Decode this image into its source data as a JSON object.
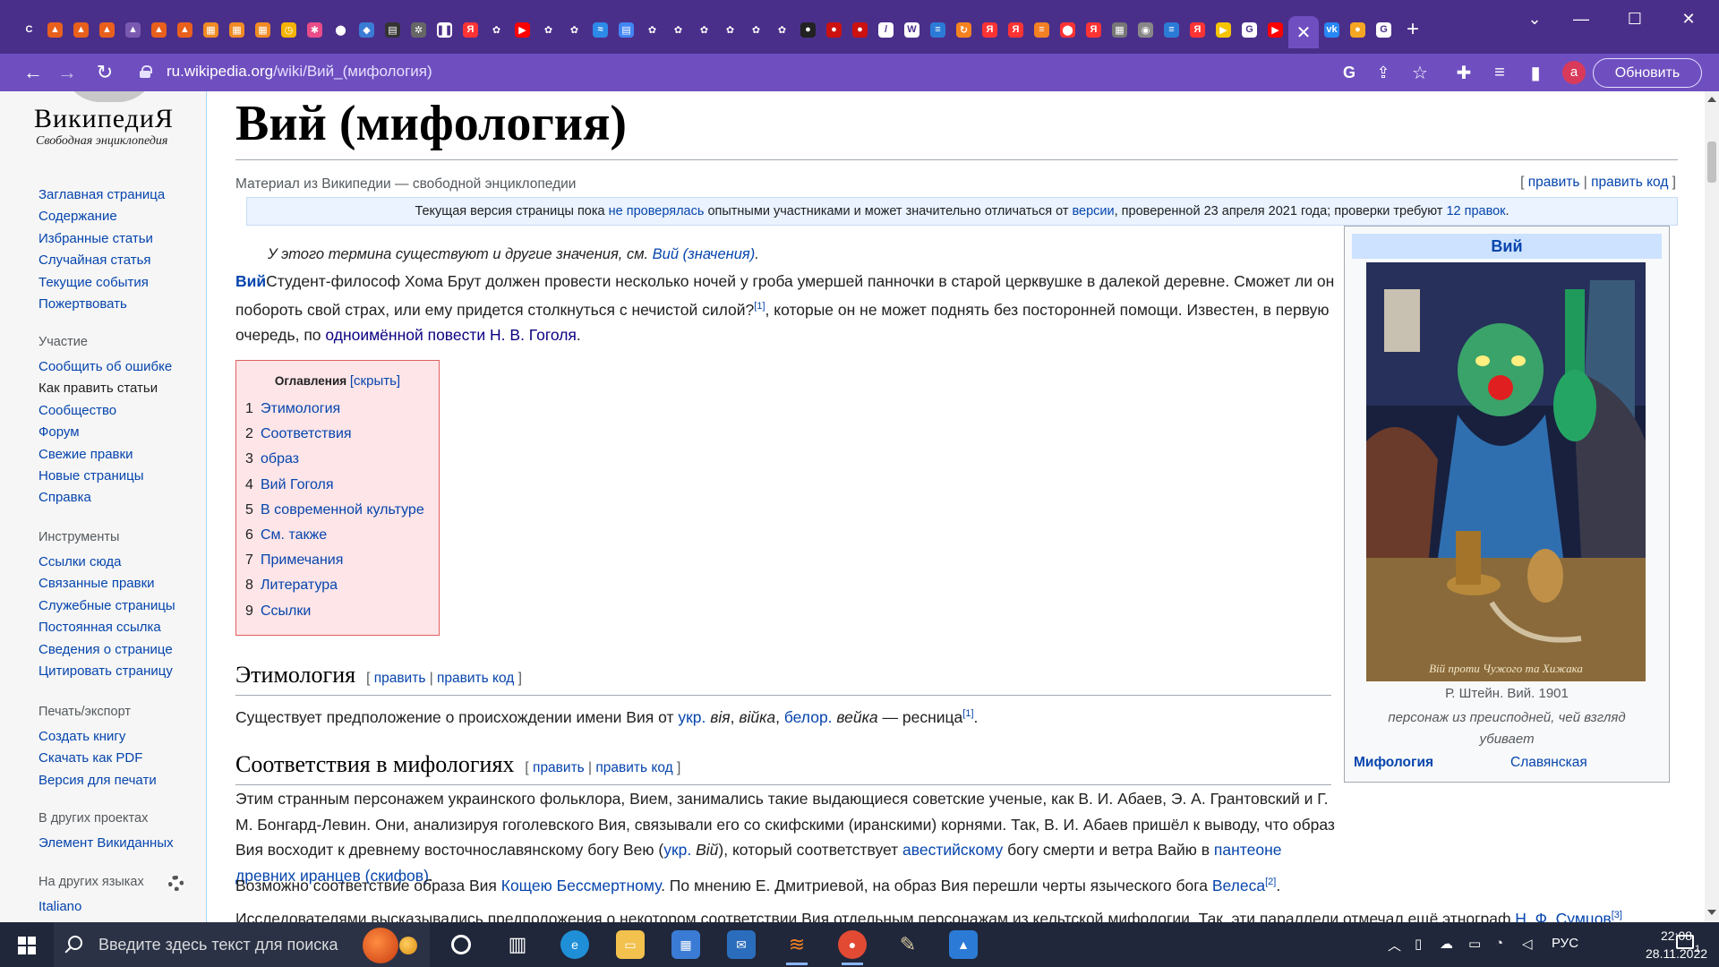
{
  "browser": {
    "tabs": [
      {
        "icon": "letter-c-icon",
        "color": "#4a2f8a",
        "glyph": "С"
      },
      {
        "icon": "flame-icon",
        "color": "#e8601c",
        "glyph": "▲"
      },
      {
        "icon": "flame-icon",
        "color": "#e8601c",
        "glyph": "▲"
      },
      {
        "icon": "flame-icon",
        "color": "#e8601c",
        "glyph": "▲"
      },
      {
        "icon": "flame-icon",
        "color": "#7a5ab0",
        "glyph": "▲"
      },
      {
        "icon": "flame-icon",
        "color": "#e8601c",
        "glyph": "▲"
      },
      {
        "icon": "flame-icon",
        "color": "#e8601c",
        "glyph": "▲"
      },
      {
        "icon": "blocks-icon",
        "color": "#f08a24",
        "glyph": "▦"
      },
      {
        "icon": "blocks-icon",
        "color": "#f08a24",
        "glyph": "▦"
      },
      {
        "icon": "blocks-icon",
        "color": "#f08a24",
        "glyph": "▦"
      },
      {
        "icon": "clock-icon",
        "color": "#f5b400",
        "glyph": "◷"
      },
      {
        "icon": "colorful-icon",
        "color": "#e94c88",
        "glyph": "✱"
      },
      {
        "icon": "pin-icon",
        "color": "#4a2f8a",
        "glyph": "⬤"
      },
      {
        "icon": "diamond-icon",
        "color": "#3a7bd5",
        "glyph": "◆"
      },
      {
        "icon": "book-icon",
        "color": "#333333",
        "glyph": "▤"
      },
      {
        "icon": "gear-icon",
        "color": "#666666",
        "glyph": "✲"
      },
      {
        "icon": "pause-icon",
        "color": "#ffffff",
        "glyph": "❚❚"
      },
      {
        "icon": "yandex-icon",
        "color": "#ff3333",
        "glyph": "Я"
      },
      {
        "icon": "chatgpt-icon",
        "color": "#4a2f8a",
        "glyph": "✿"
      },
      {
        "icon": "youtube-icon",
        "color": "#ff0000",
        "glyph": "▶"
      },
      {
        "icon": "chatgpt-icon",
        "color": "#4a2f8a",
        "glyph": "✿"
      },
      {
        "icon": "chatgpt-icon",
        "color": "#4a2f8a",
        "glyph": "✿"
      },
      {
        "icon": "wave-icon",
        "color": "#2d8ae8",
        "glyph": "≈"
      },
      {
        "icon": "doc-icon",
        "color": "#4285f4",
        "glyph": "▤"
      },
      {
        "icon": "chatgpt-icon",
        "color": "#4a2f8a",
        "glyph": "✿"
      },
      {
        "icon": "chatgpt-icon",
        "color": "#4a2f8a",
        "glyph": "✿"
      },
      {
        "icon": "chatgpt-icon",
        "color": "#4a2f8a",
        "glyph": "✿"
      },
      {
        "icon": "chatgpt-icon",
        "color": "#4a2f8a",
        "glyph": "✿"
      },
      {
        "icon": "chatgpt-icon",
        "color": "#4a2f8a",
        "glyph": "✿"
      },
      {
        "icon": "chatgpt-icon",
        "color": "#4a2f8a",
        "glyph": "✿"
      },
      {
        "icon": "github-icon",
        "color": "#222222",
        "glyph": "●"
      },
      {
        "icon": "red-circle-icon",
        "color": "#cc1111",
        "glyph": "●"
      },
      {
        "icon": "red-circle-icon",
        "color": "#cc1111",
        "glyph": "●"
      },
      {
        "icon": "slash-icon",
        "color": "#ffffff",
        "glyph": "/"
      },
      {
        "icon": "wikipedia-icon",
        "color": "#ffffff",
        "glyph": "W"
      },
      {
        "icon": "stack-icon",
        "color": "#2b7bd6",
        "glyph": "≡"
      },
      {
        "icon": "refresh-icon",
        "color": "#f58220",
        "glyph": "↻"
      },
      {
        "icon": "yandex-icon",
        "color": "#ff3333",
        "glyph": "Я"
      },
      {
        "icon": "yandex-icon",
        "color": "#ff3333",
        "glyph": "Я"
      },
      {
        "icon": "stack-overflow-icon",
        "color": "#f48024",
        "glyph": "≡"
      },
      {
        "icon": "map-pin-icon",
        "color": "#ff3333",
        "glyph": "⬤"
      },
      {
        "icon": "yandex-icon",
        "color": "#ff3333",
        "glyph": "Я"
      },
      {
        "icon": "table-icon",
        "color": "#777777",
        "glyph": "▦"
      },
      {
        "icon": "globe-icon",
        "color": "#888888",
        "glyph": "◉"
      },
      {
        "icon": "stack-icon",
        "color": "#2b7bd6",
        "glyph": "≡"
      },
      {
        "icon": "yandex-icon",
        "color": "#ff3333",
        "glyph": "Я"
      },
      {
        "icon": "play-yellow-icon",
        "color": "#f5c400",
        "glyph": "▶"
      },
      {
        "icon": "google-icon",
        "color": "#ffffff",
        "glyph": "G"
      },
      {
        "icon": "youtube-icon",
        "color": "#ff0000",
        "glyph": "▶"
      }
    ],
    "tabs_after": [
      {
        "icon": "vk-icon",
        "color": "#2787f5",
        "glyph": "vk"
      },
      {
        "icon": "fruit-icon",
        "color": "#f5a623",
        "glyph": "●"
      },
      {
        "icon": "google-icon",
        "color": "#ffffff",
        "glyph": "G"
      }
    ],
    "url_domain": "ru.wikipedia.org",
    "url_path": "/wiki/Вий_(мифология)",
    "profile_letter": "а",
    "update_label": "Обновить"
  },
  "sidebar": {
    "logo_title": "ВикипедиЯ",
    "logo_sub": "Свободная энциклопедия",
    "main_links": [
      "Заглавная страница",
      "Содержание",
      "Избранные статьи",
      "Случайная статья",
      "Текущие события",
      "Пожертвовать"
    ],
    "participation_heading": "Участие",
    "participation_links": [
      "Сообщить об ошибке",
      "Как править статьи",
      "Сообщество",
      "Форум",
      "Свежие правки",
      "Новые страницы",
      "Справка"
    ],
    "tools_heading": "Инструменты",
    "tools_links": [
      "Ссылки сюда",
      "Связанные правки",
      "Служебные страницы",
      "Постоянная ссылка",
      "Сведения о странице",
      "Цитировать страницу"
    ],
    "print_heading": "Печать/экспорт",
    "print_links": [
      "Создать книгу",
      "Скачать как PDF",
      "Версия для печати"
    ],
    "projects_heading": "В других проектах",
    "projects_links": [
      "Элемент Викиданных"
    ],
    "languages_heading": "На других языках",
    "languages_links": [
      "Italiano"
    ]
  },
  "article": {
    "title": "Вий (мифология)",
    "tagline": "Материал из Википедии — свободной энциклопедии",
    "edit_links": {
      "open": "[ ",
      "edit": "править",
      "sep": " | ",
      "edit_code": "править код",
      "close": " ]"
    },
    "flagged": {
      "t1": "Текущая версия страницы пока ",
      "l1": "не проверялась",
      "t2": " опытными участниками и может значительно отличаться от ",
      "l2": "версии",
      "t3": ", проверенной 23 апреля 2021 года; проверки требуют ",
      "l3": "12 правок",
      "t4": "."
    },
    "hatnote": {
      "text": "У этого термина существуют и другие значения, см. ",
      "link": "Вий (значения)",
      "end": "."
    },
    "intro": {
      "bold": "Вий",
      "t1": "Студент-философ Хома Брут должен провести несколько ночей у гроба умершей панночки в старой церквушке в далекой деревне. Сможет ли он побороть свой страх, или ему придется столкнуться с нечистой силой?",
      "sup1": "[1]",
      "t2": ", которые он не может поднять без посторонней помощи. Известен, в первую очередь, по ",
      "link": "одноимённой повести Н. В. Гоголя",
      "end": "."
    },
    "toc": {
      "title": "Оглавления",
      "hide": "[скрыть]",
      "items": [
        {
          "num": "1",
          "label": "Этимология"
        },
        {
          "num": "2",
          "label": "Соответствия"
        },
        {
          "num": "3",
          "label": "образ"
        },
        {
          "num": "4",
          "label": "Вий Гоголя"
        },
        {
          "num": "5",
          "label": "В современной культуре"
        },
        {
          "num": "6",
          "label": "См. также"
        },
        {
          "num": "7",
          "label": "Примечания"
        },
        {
          "num": "8",
          "label": "Литература"
        },
        {
          "num": "9",
          "label": "Ссылки"
        }
      ]
    },
    "etymology": {
      "heading": "Этимология",
      "text1": "Существует предположение о происхождении имени Вия от ",
      "l1": "укр.",
      "i1": "вія",
      "sep1": ", ",
      "i2": "війка",
      "sep2": ", ",
      "l2": "белор.",
      "i3": "вейка",
      "dash": " — ресница",
      "sup": "[1]",
      "end": "."
    },
    "correspondences": {
      "heading": "Соответствия в мифологиях",
      "p1_t1": "Этим странным персонажем украинского фольклора, Вием, занимались такие выдающиеся советские ученые, как В. И. Абаев, Э. А. Грантовский и Г. М. Бонгард-Левин. Они, анализируя гоголевского Вия, связывали его со скифскими (иранскими) корнями. Так, В. И. Абаев пришёл к выводу, что образ Вия восходит к древнему восточнославянскому богу Вею (",
      "p1_l1": "укр.",
      "p1_i1": "Вій",
      "p1_t2": "), который соответствует ",
      "p1_l2": "авестийскому",
      "p1_t3": " богу смерти и ветра Вайю в ",
      "p1_l3": "пантеоне древних иранцев (скифов)",
      "p1_end": ".",
      "p2_t1": "Возможно соответствие образа Вия ",
      "p2_l1": "Кощею Бессмертному",
      "p2_t2": ". По мнению Е. Дмитриевой, на образ Вия перешли черты языческого бога ",
      "p2_l2": "Велеса",
      "p2_sup": "[2]",
      "p2_end": ".",
      "p3_t1": "Исследователями высказывались предположения о некотором соответствии Вия отдельным персонажам из кельтской мифологии. Так, эти параллели отмечал ещё этнограф ",
      "p3_l1": "Н. Ф. Сумцов",
      "p3_sup": "[3]"
    },
    "infobox": {
      "title": "Вий",
      "image_text": "Вій проти Чужого та Хижака",
      "caption": "Р. Штейн. Вий. 1901",
      "description": "персонаж из преисподней, чей взгляд убивает",
      "row_key": "Мифология",
      "row_value": "Славянская"
    }
  },
  "taskbar": {
    "search_placeholder": "Введите здесь текст для поиска",
    "lang": "РУС",
    "time": "22:08",
    "date": "28.11.2022",
    "notification_count": "1"
  }
}
